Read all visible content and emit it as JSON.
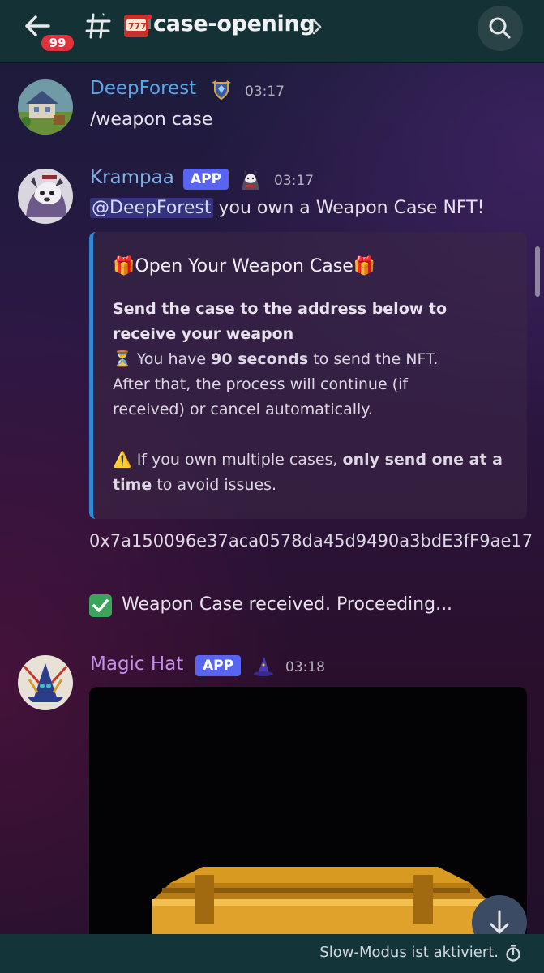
{
  "header": {
    "unread_badge": "99",
    "channel_name": "case-opening"
  },
  "messages": [
    {
      "username": "DeepForest",
      "username_color": "#5aa7e8",
      "time": "03:17",
      "text": "/weapon case"
    },
    {
      "username": "Krampaa",
      "username_color": "#7fb0e6",
      "app_tag": "APP",
      "time": "03:17",
      "mention": "@DeepForest",
      "text": " you own a Weapon Case NFT!",
      "embed": {
        "title": "🎁Open Your Weapon Case🎁",
        "bold_line": "Send the case to the address below to receive your weapon",
        "timer_prefix": "⏳ You have ",
        "timer_bold": "90 seconds",
        "timer_suffix": " to send the NFT.",
        "continue_line": "After that, the process will continue (if received) or cancel automatically.",
        "warning_prefix": "⚠️ If you own multiple cases, ",
        "warning_bold": "only send one at a time",
        "warning_suffix": " to avoid issues."
      },
      "address": "0x7a150096e37aca0578da45d9490a3bdE3fF9ae17",
      "status": "Weapon Case received. Proceeding..."
    },
    {
      "username": "Magic Hat",
      "username_color": "#c58fe8",
      "app_tag": "APP",
      "time": "03:18"
    }
  ],
  "footer": {
    "slow_mode": "Slow-Modus ist aktiviert."
  },
  "colors": {
    "header_bg": "#143236",
    "badge_red": "#e0323b",
    "app_tag_bg": "#5865f2",
    "embed_border": "#2f87d6",
    "success_green": "#3ba55c"
  },
  "icons": [
    "back-arrow-icon",
    "hash-icon",
    "slot-machine-icon",
    "chevron-right-icon",
    "search-icon",
    "shield-badge-icon",
    "husky-icon",
    "wizard-hat-icon",
    "check-icon",
    "arrow-down-icon",
    "timer-icon"
  ]
}
